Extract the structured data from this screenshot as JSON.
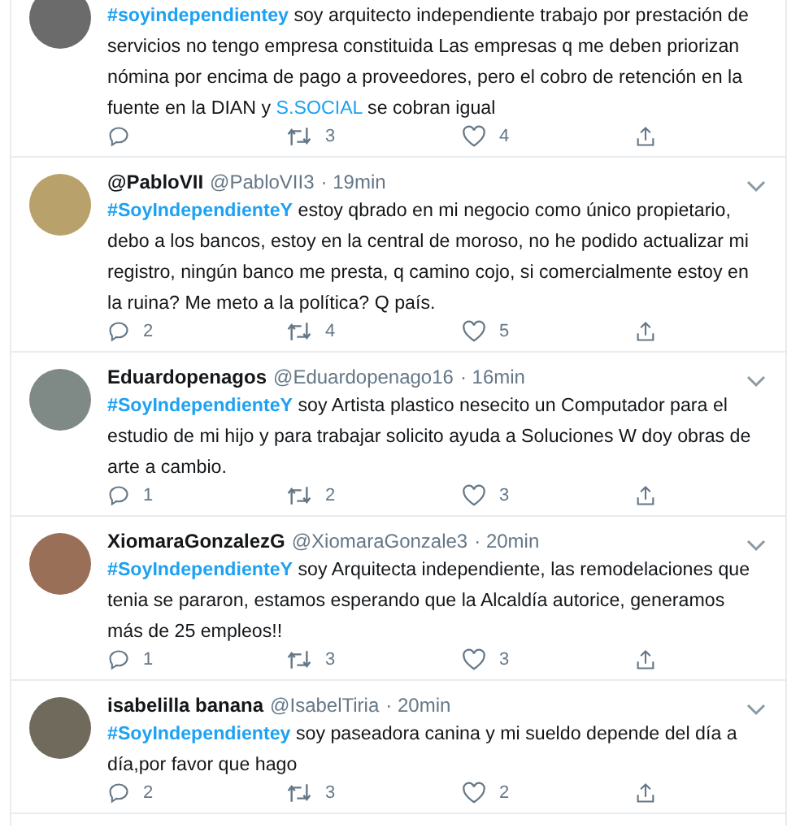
{
  "tweets": [
    {
      "parts": [
        {
          "kind": "hashtag",
          "text": "#soyindependientey"
        },
        {
          "kind": "text",
          "text": " soy arquitecto independiente trabajo por prestación de servicios no tengo empresa constituida Las empresas q me deben priorizan nómina por encima de pago a proveedores, pero el cobro de retención en la fuente en la DIAN y "
        },
        {
          "kind": "link",
          "text": "S.SOCIAL"
        },
        {
          "kind": "text",
          "text": " se cobran igual"
        }
      ],
      "retweets": "3",
      "likes": "4",
      "cropped": true
    },
    {
      "name": "@PabloVII",
      "handle": "@PabloVII3",
      "time": "· 19min",
      "parts": [
        {
          "kind": "hashtag",
          "text": "#SoyIndependienteY"
        },
        {
          "kind": "text",
          "text": " estoy qbrado en mi negocio como único propietario, debo a los bancos, estoy en la central de moroso, no he podido actualizar mi registro, ningún banco me presta, q camino cojo, si comercialmente estoy en la ruina? Me meto a la política? Q país."
        }
      ],
      "replies": "2",
      "retweets": "4",
      "likes": "5",
      "cropped": false
    },
    {
      "name": "Eduardopenagos",
      "handle": "@Eduardopenago16",
      "time": "· 16min",
      "parts": [
        {
          "kind": "hashtag",
          "text": "#SoyIndependienteY"
        },
        {
          "kind": "text",
          "text": " soy Artista plastico nesecito un Computador para el estudio de mi hijo y para trabajar solicito ayuda a Soluciones W doy obras de arte a cambio."
        }
      ],
      "replies": "1",
      "retweets": "2",
      "likes": "3",
      "cropped": false
    },
    {
      "name": "XiomaraGonzalezG",
      "handle": "@XiomaraGonzale3",
      "time": "· 20min",
      "parts": [
        {
          "kind": "hashtag",
          "text": "#SoyIndependienteY"
        },
        {
          "kind": "text",
          "text": " soy Arquitecta independiente, las remodelaciones que tenia se pararon, estamos esperando que la Alcaldía autorice, generamos más de 25 empleos!!"
        }
      ],
      "replies": "1",
      "retweets": "3",
      "likes": "3",
      "cropped": false
    },
    {
      "name": "isabelilla banana",
      "handle": "@IsabelTiria",
      "time": "· 20min",
      "parts": [
        {
          "kind": "hashtag",
          "text": "#SoyIndependientey"
        },
        {
          "kind": "text",
          "text": " soy paseadora canina y mi sueldo depende del día a día,por favor que hago"
        }
      ],
      "replies": "2",
      "retweets": "3",
      "likes": "2",
      "cropped": false
    }
  ]
}
